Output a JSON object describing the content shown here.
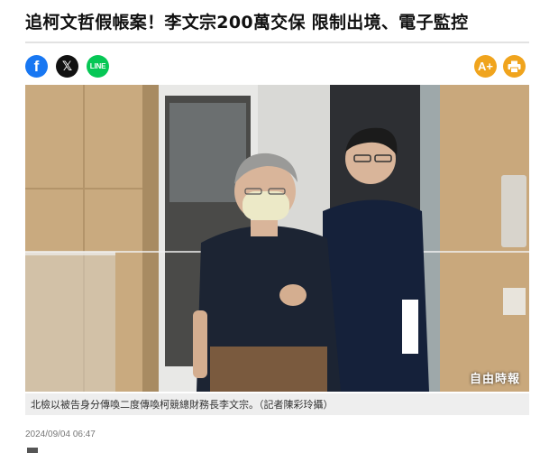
{
  "article": {
    "headline": "追柯文哲假帳案！李文宗200萬交保 限制出境、電子監控",
    "caption": "北檢以被告身分傳喚二度傳喚柯競總財務長李文宗。（記者陳彩玲攝）",
    "watermark": "自由時報",
    "timestamp": "2024/09/04 06:47"
  },
  "share": {
    "facebook_label": "f",
    "x_label": "𝕏",
    "line_label": "LINE"
  },
  "tools": {
    "font_size_label": "A+",
    "print_icon": "print-icon"
  },
  "colors": {
    "facebook": "#1877f2",
    "x": "#111111",
    "line": "#06c755",
    "tool_accent": "#f0a41d"
  }
}
